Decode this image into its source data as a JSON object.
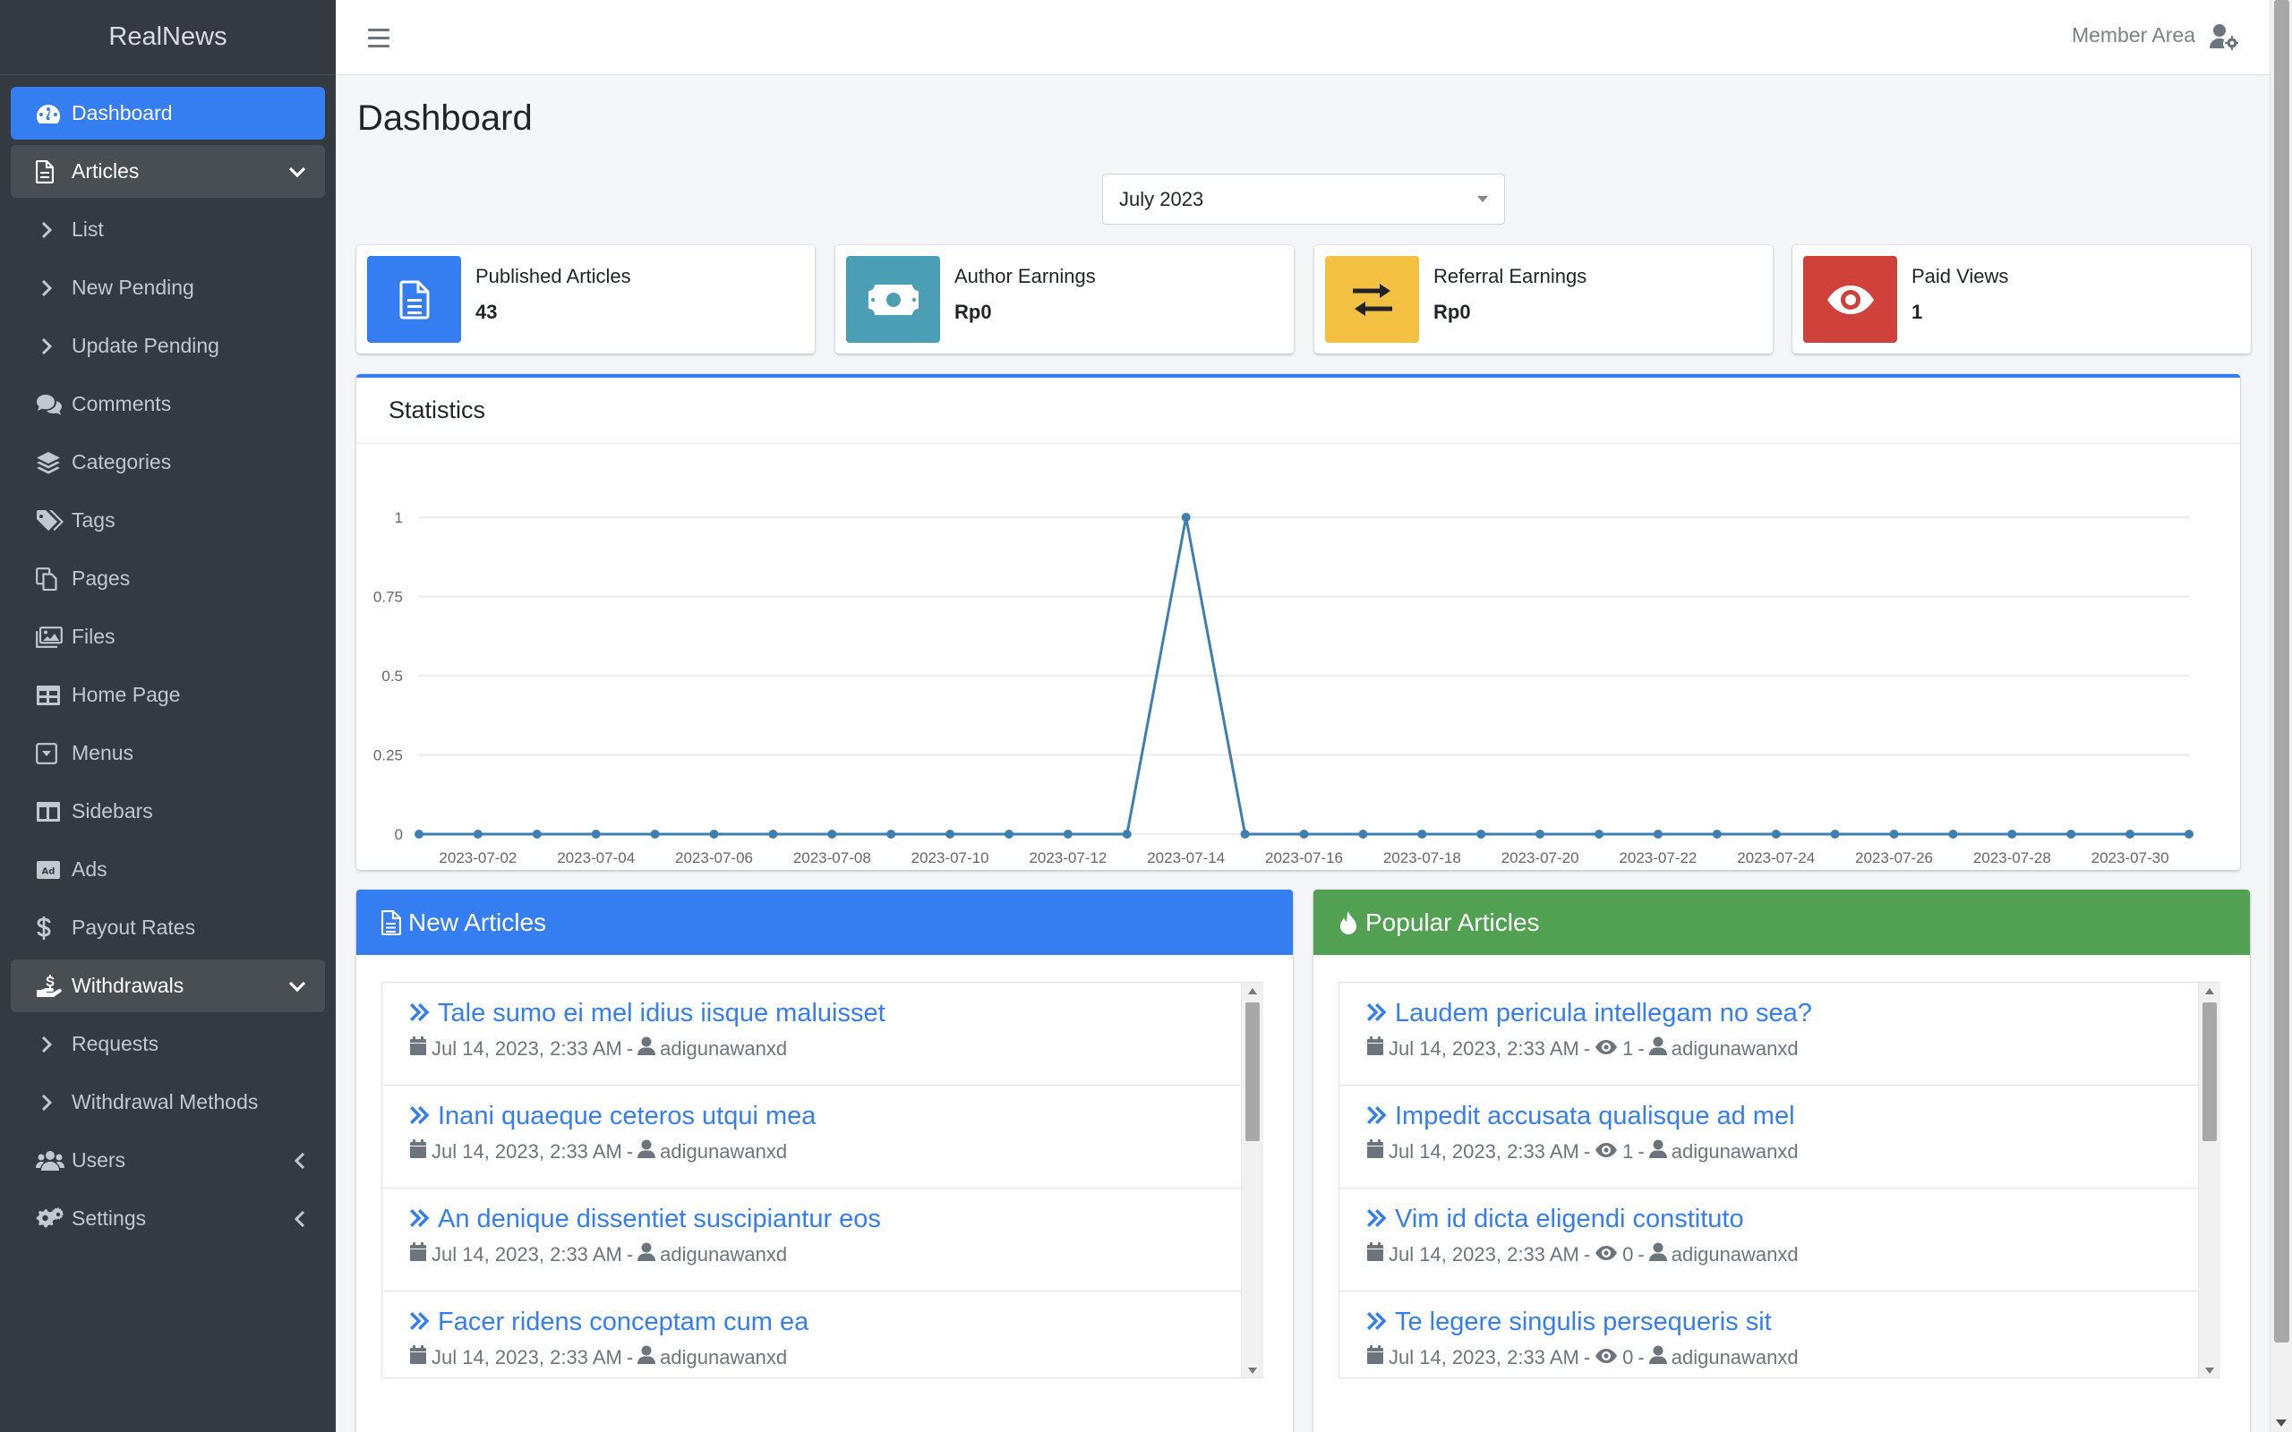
{
  "app": {
    "brand": "RealNews"
  },
  "sidebar": {
    "items": [
      {
        "label": "Dashboard",
        "icon": "tachometer-icon",
        "state": "active"
      },
      {
        "label": "Articles",
        "icon": "file-icon",
        "state": "open",
        "arrow": "chevron-down-icon"
      },
      {
        "label": "List",
        "icon": "chevron-right-icon",
        "sub": true
      },
      {
        "label": "New Pending",
        "icon": "chevron-right-icon",
        "sub": true
      },
      {
        "label": "Update Pending",
        "icon": "chevron-right-icon",
        "sub": true
      },
      {
        "label": "Comments",
        "icon": "comments-icon"
      },
      {
        "label": "Categories",
        "icon": "layers-icon"
      },
      {
        "label": "Tags",
        "icon": "tags-icon"
      },
      {
        "label": "Pages",
        "icon": "copy-icon"
      },
      {
        "label": "Files",
        "icon": "images-icon"
      },
      {
        "label": "Home Page",
        "icon": "table-icon"
      },
      {
        "label": "Menus",
        "icon": "caret-square-icon"
      },
      {
        "label": "Sidebars",
        "icon": "columns-icon"
      },
      {
        "label": "Ads",
        "icon": "ad-icon"
      },
      {
        "label": "Payout Rates",
        "icon": "dollar-icon"
      },
      {
        "label": "Withdrawals",
        "icon": "hand-holding-usd-icon",
        "state": "open",
        "arrow": "chevron-down-icon"
      },
      {
        "label": "Requests",
        "icon": "chevron-right-icon",
        "sub": true
      },
      {
        "label": "Withdrawal Methods",
        "icon": "chevron-right-icon",
        "sub": true
      },
      {
        "label": "Users",
        "icon": "users-icon",
        "arrow": "chevron-left-icon"
      },
      {
        "label": "Settings",
        "icon": "cogs-icon",
        "arrow": "chevron-left-icon"
      }
    ]
  },
  "topbar": {
    "member_area": "Member Area",
    "user_icon": "user-cog-icon",
    "menu_icon": "bars-icon"
  },
  "page": {
    "title": "Dashboard"
  },
  "filter": {
    "month": "July 2023"
  },
  "info_boxes": [
    {
      "label": "Published Articles",
      "value": "43",
      "color": "#357ef2",
      "icon": "file-alt-icon"
    },
    {
      "label": "Author Earnings",
      "value": "Rp0",
      "color": "#4a9fb5",
      "icon": "money-bill-icon"
    },
    {
      "label": "Referral Earnings",
      "value": "Rp0",
      "color": "#f4c042",
      "icon": "exchange-icon"
    },
    {
      "label": "Paid Views",
      "value": "1",
      "color": "#d0413b",
      "icon": "eye-icon"
    }
  ],
  "statistics": {
    "title": "Statistics"
  },
  "chart_data": {
    "type": "line",
    "x": [
      "2023-07-01",
      "2023-07-02",
      "2023-07-03",
      "2023-07-04",
      "2023-07-05",
      "2023-07-06",
      "2023-07-07",
      "2023-07-08",
      "2023-07-09",
      "2023-07-10",
      "2023-07-11",
      "2023-07-12",
      "2023-07-13",
      "2023-07-14",
      "2023-07-15",
      "2023-07-16",
      "2023-07-17",
      "2023-07-18",
      "2023-07-19",
      "2023-07-20",
      "2023-07-21",
      "2023-07-22",
      "2023-07-23",
      "2023-07-24",
      "2023-07-25",
      "2023-07-26",
      "2023-07-27",
      "2023-07-28",
      "2023-07-29",
      "2023-07-30",
      "2023-07-31"
    ],
    "x_tick_labels": [
      "2023-07-02",
      "2023-07-04",
      "2023-07-06",
      "2023-07-08",
      "2023-07-10",
      "2023-07-12",
      "2023-07-14",
      "2023-07-16",
      "2023-07-18",
      "2023-07-20",
      "2023-07-22",
      "2023-07-24",
      "2023-07-26",
      "2023-07-28",
      "2023-07-30"
    ],
    "series": [
      {
        "values": [
          0,
          0,
          0,
          0,
          0,
          0,
          0,
          0,
          0,
          0,
          0,
          0,
          0,
          1,
          0,
          0,
          0,
          0,
          0,
          0,
          0,
          0,
          0,
          0,
          0,
          0,
          0,
          0,
          0,
          0,
          0
        ],
        "color": "#3d7fb0"
      }
    ],
    "y_ticks": [
      "0",
      "0.25",
      "0.5",
      "0.75",
      "1"
    ],
    "ylim": [
      0,
      1
    ],
    "grid": true,
    "legend": "none"
  },
  "new_articles": {
    "title": "New Articles",
    "header_color": "#357ef2",
    "icon": "file-alt-icon",
    "items": [
      {
        "title": "Tale sumo ei mel idius iisque maluisset",
        "date": "Jul 14, 2023, 2:33 AM",
        "author": "adigunawanxd"
      },
      {
        "title": "Inani quaeque ceteros utqui mea",
        "date": "Jul 14, 2023, 2:33 AM",
        "author": "adigunawanxd"
      },
      {
        "title": "An denique dissentiet suscipiantur eos",
        "date": "Jul 14, 2023, 2:33 AM",
        "author": "adigunawanxd"
      },
      {
        "title": "Facer ridens conceptam cum ea",
        "date": "Jul 14, 2023, 2:33 AM",
        "author": "adigunawanxd"
      }
    ]
  },
  "popular_articles": {
    "title": "Popular Articles",
    "header_color": "#52a152",
    "icon": "fire-icon",
    "items": [
      {
        "title": "Laudem pericula intellegam no sea?",
        "date": "Jul 14, 2023, 2:33 AM",
        "views": "1",
        "author": "adigunawanxd"
      },
      {
        "title": "Impedit accusata qualisque ad mel",
        "date": "Jul 14, 2023, 2:33 AM",
        "views": "1",
        "author": "adigunawanxd"
      },
      {
        "title": "Vim id dicta eligendi constituto",
        "date": "Jul 14, 2023, 2:33 AM",
        "views": "0",
        "author": "adigunawanxd"
      },
      {
        "title": "Te legere singulis persequeris sit",
        "date": "Jul 14, 2023, 2:33 AM",
        "views": "0",
        "author": "adigunawanxd"
      }
    ]
  },
  "meta_separator": "-"
}
